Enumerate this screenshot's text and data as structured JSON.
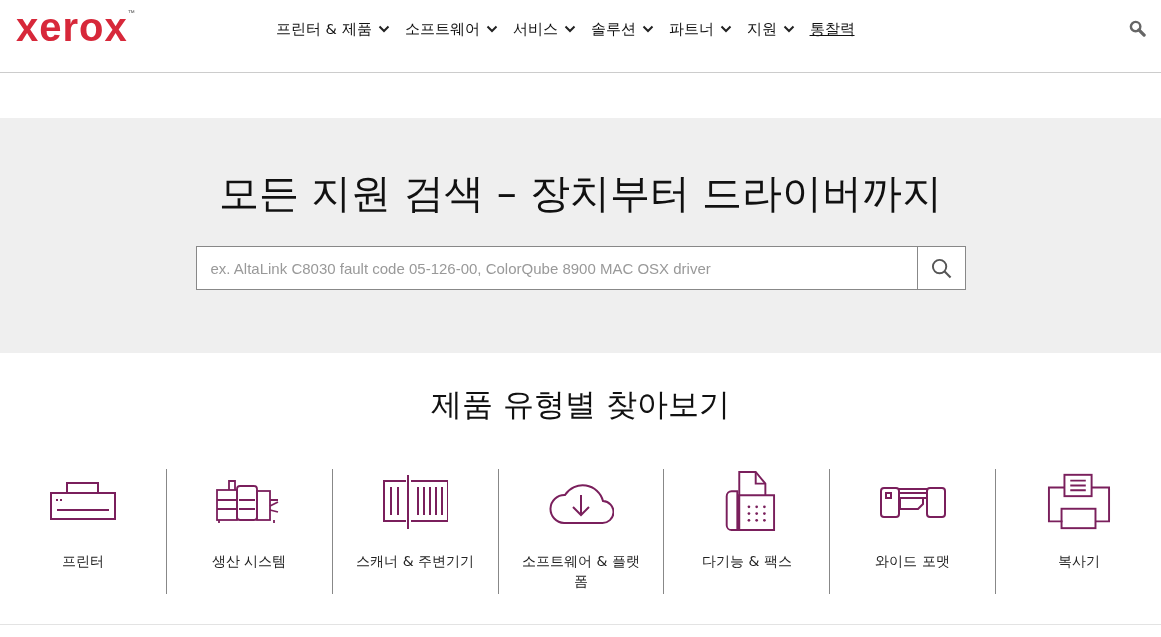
{
  "header": {
    "logo": "xerox",
    "logo_mark": "™",
    "nav": [
      {
        "label": "프린터 & 제품",
        "kind": "dropdown"
      },
      {
        "label": "소프트웨어",
        "kind": "dropdown"
      },
      {
        "label": "서비스",
        "kind": "dropdown"
      },
      {
        "label": "솔루션",
        "kind": "dropdown"
      },
      {
        "label": "파트너",
        "kind": "dropdown"
      },
      {
        "label": "지원",
        "kind": "dropdown"
      },
      {
        "label": "통찰력",
        "kind": "link"
      }
    ]
  },
  "hero": {
    "title": "모든 지원 검색 – 장치부터 드라이버까지",
    "search": {
      "placeholder": "ex. AltaLink C8030 fault code 05-126-00, ColorQube 8900 MAC OSX driver"
    }
  },
  "browse": {
    "title": "제품 유형별 찾아보기",
    "categories": [
      {
        "label": "프린터",
        "kind": "printer"
      },
      {
        "label": "생산 시스템",
        "kind": "production"
      },
      {
        "label": "스캐너 & 주변기기",
        "kind": "scanner"
      },
      {
        "label": "소프트웨어 & 플랫폼",
        "kind": "software"
      },
      {
        "label": "다기능 & 팩스",
        "kind": "fax"
      },
      {
        "label": "와이드 포맷",
        "kind": "wide"
      },
      {
        "label": "복사기",
        "kind": "copier"
      }
    ]
  }
}
